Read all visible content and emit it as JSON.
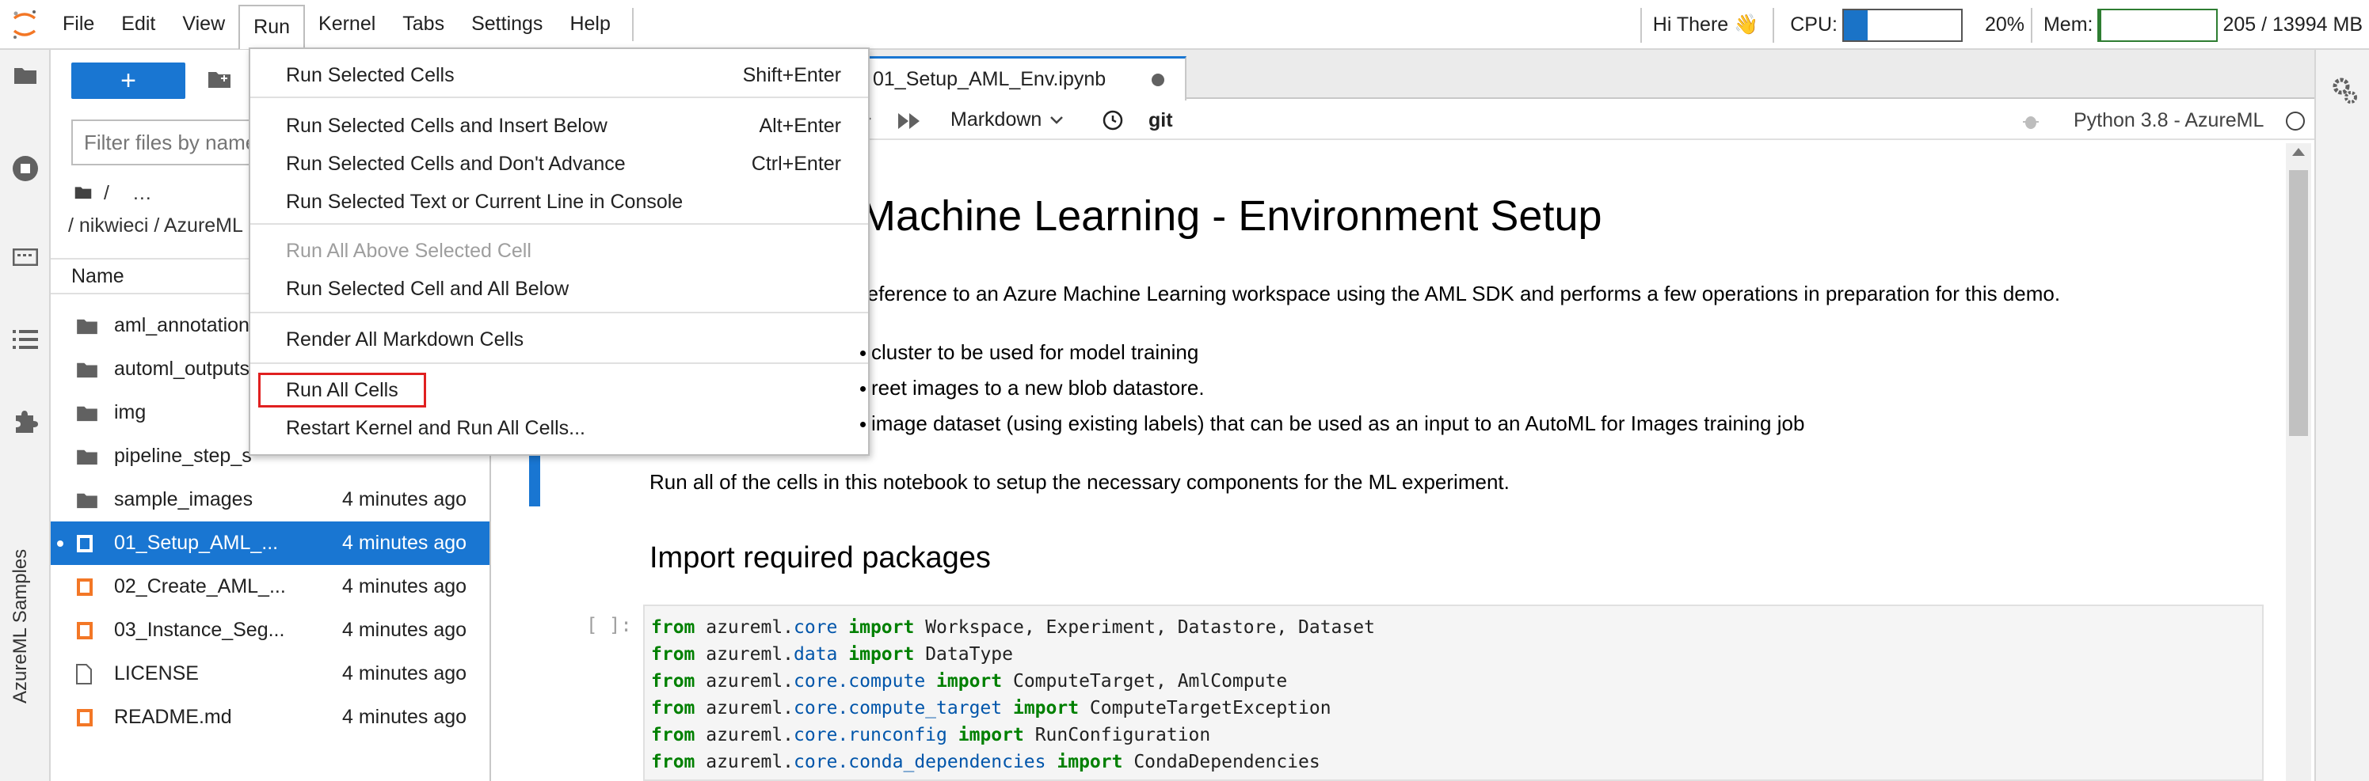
{
  "menubar": {
    "items": [
      "File",
      "Edit",
      "View",
      "Run",
      "Kernel",
      "Tabs",
      "Settings",
      "Help"
    ],
    "greeting": "Hi There 👋",
    "cpu_label": "CPU:",
    "cpu_value": "20%",
    "cpu_fraction": 0.2,
    "mem_label": "Mem:",
    "mem_value": "205 / 13994 MB",
    "mem_fraction": 0.015
  },
  "rail": {
    "label": "AzureML Samples"
  },
  "filebrowser": {
    "new_button": "+",
    "filter_placeholder": "Filter files by name",
    "crumb_root": "/",
    "crumb_more": "…",
    "crumb_path": "/ nikwieci / AzureML",
    "header_name": "Name",
    "files": [
      {
        "name": "aml_annotations",
        "type": "folder",
        "modified": ""
      },
      {
        "name": "automl_outputs",
        "type": "folder",
        "modified": ""
      },
      {
        "name": "img",
        "type": "folder",
        "modified": ""
      },
      {
        "name": "pipeline_step_s",
        "type": "folder",
        "modified": ""
      },
      {
        "name": "sample_images",
        "type": "folder",
        "modified": "4 minutes ago"
      },
      {
        "name": "01_Setup_AML_...",
        "type": "notebook",
        "modified": "4 minutes ago",
        "selected": true
      },
      {
        "name": "02_Create_AML_...",
        "type": "notebook",
        "modified": "4 minutes ago"
      },
      {
        "name": "03_Instance_Seg...",
        "type": "notebook",
        "modified": "4 minutes ago"
      },
      {
        "name": "LICENSE",
        "type": "file",
        "modified": "4 minutes ago"
      },
      {
        "name": "README.md",
        "type": "markdown",
        "modified": "4 minutes ago"
      }
    ]
  },
  "tab": {
    "title": "01_Setup_AML_Env.ipynb"
  },
  "toolbar": {
    "cell_type": "Markdown",
    "git_label": "git",
    "kernel": "Python 3.8 - AzureML"
  },
  "notebook": {
    "title": "Machine Learning - Environment Setup",
    "intro": "reference to an Azure Machine Learning workspace using the AML SDK and performs a few operations in preparation for this demo.",
    "bullets": [
      "cluster to be used for model training",
      "reet images to a new blob datastore.",
      "image dataset (using existing labels) that can be used as an input to an AutoML for Images training job"
    ],
    "run_all_text": "Run all of the cells in this notebook to setup the necessary components for the ML experiment.",
    "h2": "Import required packages",
    "prompt": "[ ]:",
    "code_lines": [
      {
        "module": "azureml.",
        "sub": "core",
        "imports": "Workspace, Experiment, Datastore, Dataset"
      },
      {
        "module": "azureml.",
        "sub": "data",
        "imports": "DataType"
      },
      {
        "module": "azureml.",
        "sub": "core.compute",
        "imports": "ComputeTarget, AmlCompute"
      },
      {
        "module": "azureml.",
        "sub": "core.compute_target",
        "imports": "ComputeTargetException"
      },
      {
        "module": "azureml.",
        "sub": "core.runconfig",
        "imports": "RunConfiguration"
      },
      {
        "module": "azureml.",
        "sub": "core.conda_dependencies",
        "imports": "CondaDependencies"
      }
    ],
    "kw_from": "from",
    "kw_import": "import"
  },
  "run_menu": {
    "items": [
      {
        "label": "Run Selected Cells",
        "shortcut": "Shift+Enter"
      },
      {
        "label": "Run Selected Cells and Insert Below",
        "shortcut": "Alt+Enter"
      },
      {
        "label": "Run Selected Cells and Don't Advance",
        "shortcut": "Ctrl+Enter"
      },
      {
        "label": "Run Selected Text or Current Line in Console",
        "shortcut": ""
      },
      {
        "label": "Run All Above Selected Cell",
        "shortcut": ""
      },
      {
        "label": "Run Selected Cell and All Below",
        "shortcut": ""
      },
      {
        "label": "Render All Markdown Cells",
        "shortcut": ""
      },
      {
        "label": "Run All Cells",
        "shortcut": ""
      },
      {
        "label": "Restart Kernel and Run All Cells...",
        "shortcut": ""
      }
    ]
  },
  "colors": {
    "accent": "#1976d2",
    "highlight_box": "#e02020",
    "logo": "#f37726"
  }
}
